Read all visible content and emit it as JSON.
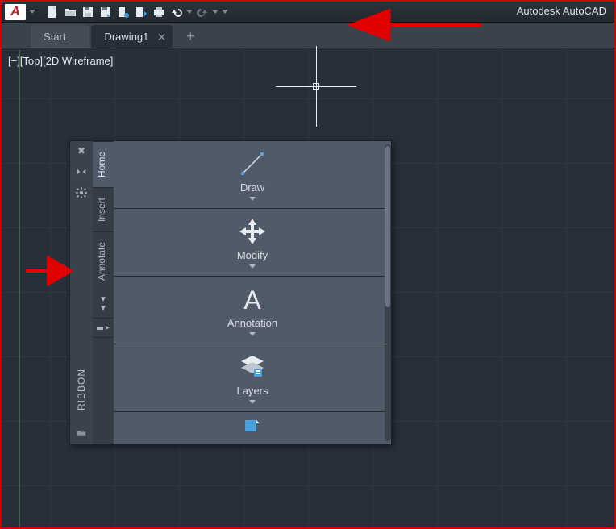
{
  "app": {
    "title": "Autodesk AutoCAD"
  },
  "tabs": {
    "start": "Start",
    "drawing": "Drawing1"
  },
  "viewport": {
    "label": "[−][Top][2D Wireframe]"
  },
  "palette": {
    "rail_label": "RIBBON",
    "vtabs": {
      "home": "Home",
      "insert": "Insert",
      "annotate": "Annotate"
    },
    "panels": {
      "draw": "Draw",
      "modify": "Modify",
      "annotation": "Annotation",
      "layers": "Layers"
    }
  }
}
